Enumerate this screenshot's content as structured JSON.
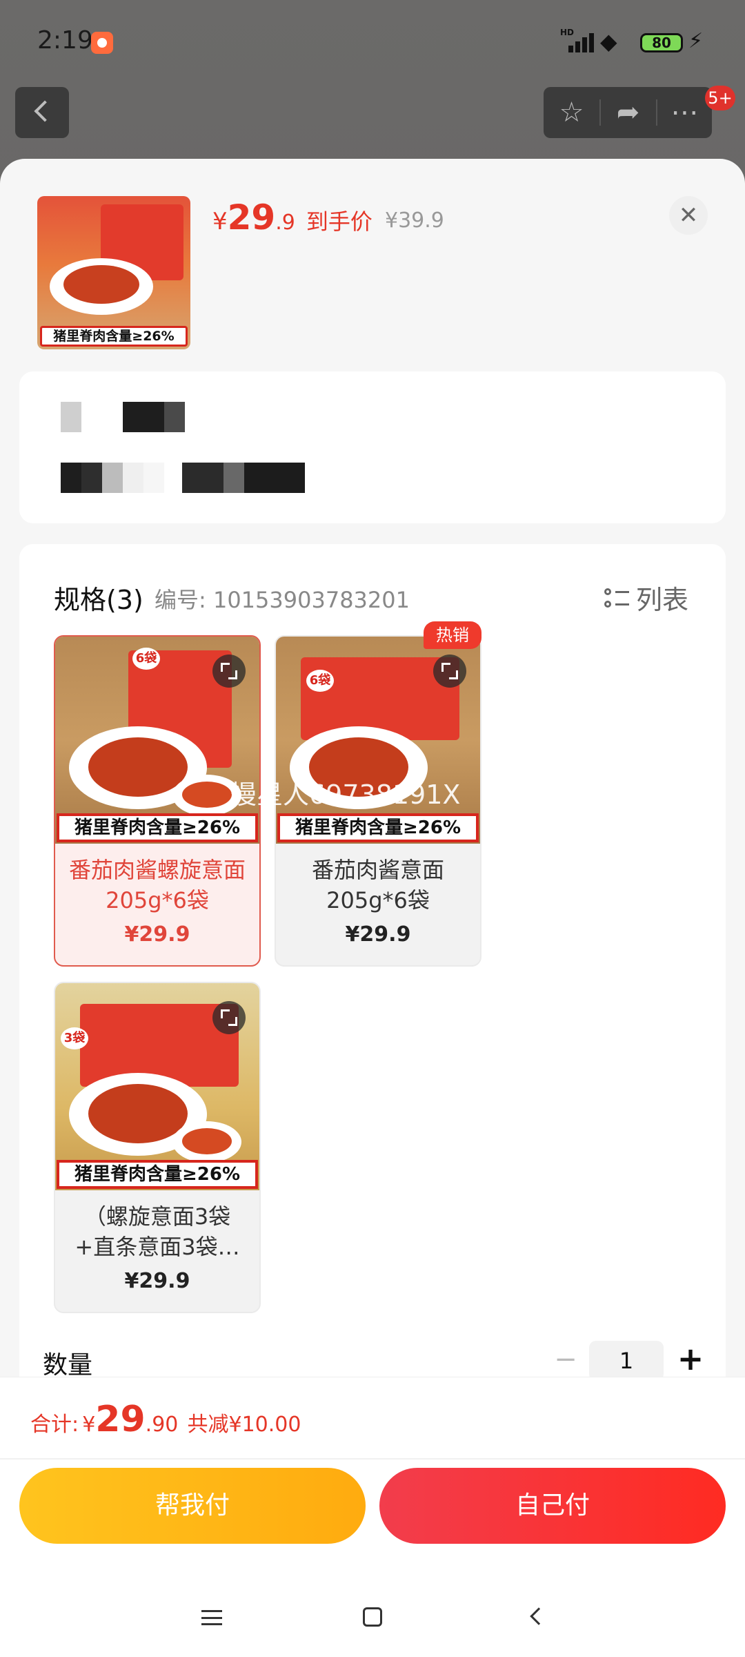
{
  "status_bar": {
    "time": "2:19",
    "network_label": "HD",
    "battery": "80"
  },
  "top_nav": {
    "notification_count": "5+"
  },
  "product": {
    "thumb_strip": "猪里脊肉含量≥26%",
    "price_currency": "¥",
    "price_int": "29",
    "price_dec": ".9",
    "price_label": "到手价",
    "original_price": "¥39.9",
    "close_icon": "close-icon"
  },
  "specs": {
    "title": "规格(3)",
    "code": "编号: 10153903783201",
    "list_toggle": "列表",
    "items": [
      {
        "tag": "6袋",
        "strip": "猪里脊肉含量≥26%",
        "name": "番茄肉酱螺旋意面 205g*6袋",
        "price": "¥29.9",
        "selected": true
      },
      {
        "tag": "6袋",
        "strip": "猪里脊肉含量≥26%",
        "name": "番茄肉酱意面 205g*6袋",
        "price": "¥29.9",
        "badge": "热销",
        "selected": false
      },
      {
        "tag": "3袋",
        "strip": "猪里脊肉含量≥26%",
        "name": "（螺旋意面3袋 +直条意面3袋…",
        "price": "¥29.9",
        "selected": false
      }
    ],
    "watermark": "慢星人69738191X"
  },
  "quantity": {
    "label": "数量",
    "minus": "−",
    "value": "1",
    "plus": "+"
  },
  "footer": {
    "total_label": "合计:",
    "total_currency": "¥",
    "total_int": "29",
    "total_dec": ".90",
    "savings": "共减¥10.00",
    "help_pay": "帮我付",
    "self_pay": "自己付"
  },
  "colors": {
    "accent": "#e53627",
    "help_button": "#ffb414",
    "self_button": "#f5312e"
  }
}
